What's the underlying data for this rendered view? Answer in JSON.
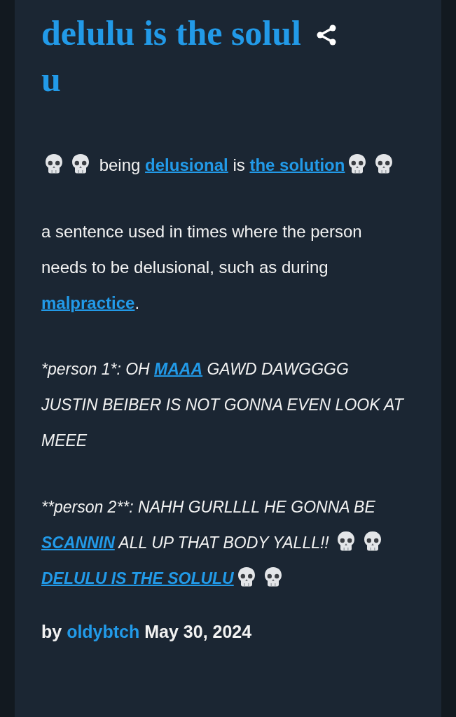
{
  "entry": {
    "title_lines": [
      "delulu is the solul",
      "u"
    ],
    "paragraphs": [
      {
        "kind": "plain",
        "segments": [
          {
            "kind": "skull"
          },
          {
            "kind": "skull"
          },
          {
            "kind": "text",
            "text": " being "
          },
          {
            "kind": "link",
            "text": "delusional"
          },
          {
            "kind": "text",
            "text": " is "
          },
          {
            "kind": "link",
            "text": "the solution"
          },
          {
            "kind": "skull"
          },
          {
            "kind": "skull"
          }
        ]
      },
      {
        "kind": "plain",
        "segments": [
          {
            "kind": "text",
            "text": "a sentence used in times where the person needs to be delusional, such as during "
          },
          {
            "kind": "link",
            "text": "malpractice"
          },
          {
            "kind": "text",
            "text": "."
          }
        ]
      },
      {
        "kind": "italic",
        "segments": [
          {
            "kind": "text",
            "text": "*person 1*: OH "
          },
          {
            "kind": "link",
            "text": "MAAA"
          },
          {
            "kind": "text",
            "text": " GAWD DAWGGGG JUSTIN BEIBER IS NOT GONNA EVEN LOOK AT MEEE"
          }
        ]
      },
      {
        "kind": "italic",
        "segments": [
          {
            "kind": "text",
            "text": "**person 2**: NAHH GURLLLL HE GONNA BE "
          },
          {
            "kind": "link",
            "text": "SCANNIN"
          },
          {
            "kind": "text",
            "text": " ALL UP THAT BODY YALLL!! "
          },
          {
            "kind": "skull"
          },
          {
            "kind": "skull"
          },
          {
            "kind": "link",
            "text": "DELULU IS THE SOLULU"
          },
          {
            "kind": "skull"
          },
          {
            "kind": "skull"
          }
        ]
      }
    ],
    "byline": {
      "prefix": "by",
      "author": "oldybtch",
      "date": "May 30, 2024"
    }
  }
}
